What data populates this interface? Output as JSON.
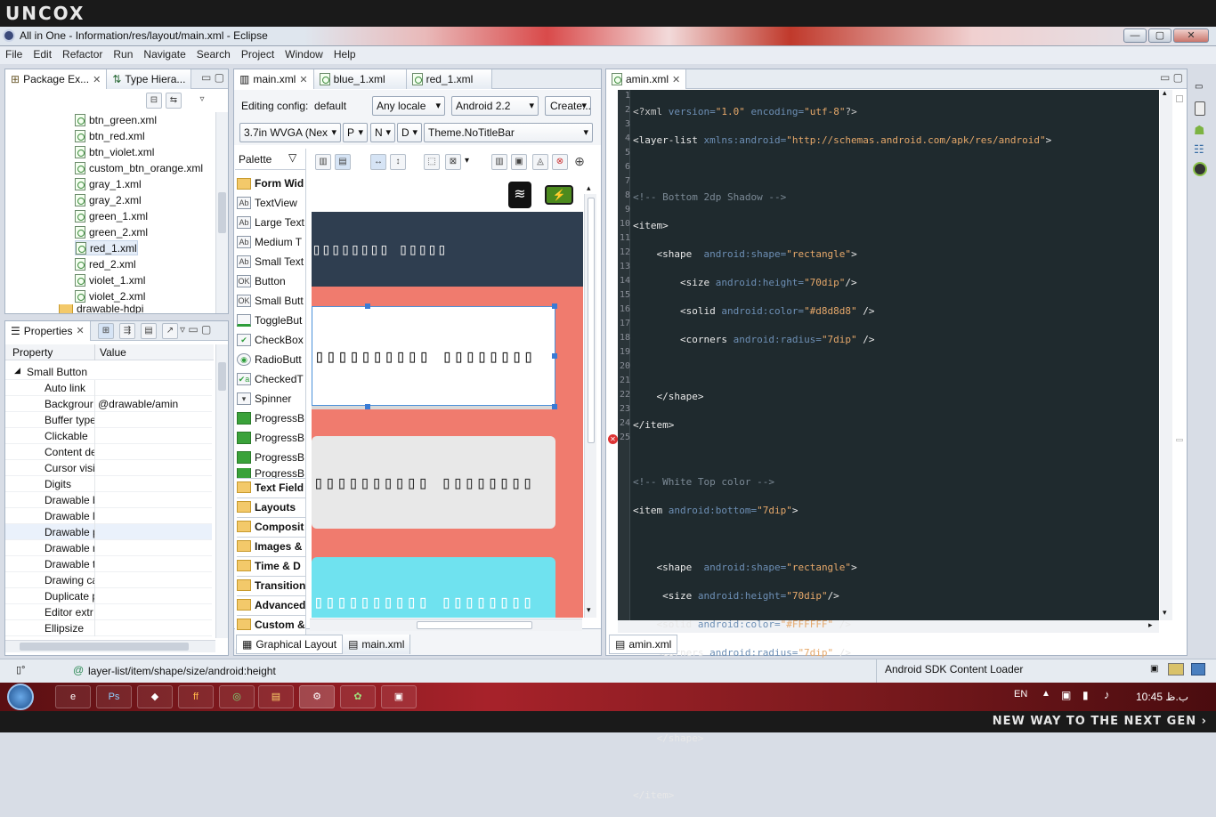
{
  "brand": {
    "logo": "UNCOX",
    "tagline": "NEW WAY TO THE NEXT GEN ›"
  },
  "window": {
    "title": "All in One - Information/res/layout/main.xml - Eclipse",
    "min": "—",
    "max": "▢",
    "close": "✕"
  },
  "menu": [
    "File",
    "Edit",
    "Refactor",
    "Run",
    "Navigate",
    "Search",
    "Project",
    "Window",
    "Help"
  ],
  "package_explorer": {
    "tabs": [
      "Package Ex...",
      "Type Hiera..."
    ],
    "files": [
      "btn_green.xml",
      "btn_red.xml",
      "btn_violet.xml",
      "custom_btn_orange.xml",
      "gray_1.xml",
      "gray_2.xml",
      "green_1.xml",
      "green_2.xml",
      "red_1.xml",
      "red_2.xml",
      "violet_1.xml",
      "violet_2.xml"
    ],
    "selected_index": 8,
    "folder": "drawable-hdpi"
  },
  "properties": {
    "tab": "Properties",
    "col_property": "Property",
    "col_value": "Value",
    "group": "Small Button",
    "rows": [
      {
        "k": "Auto link",
        "v": ""
      },
      {
        "k": "Backgrour",
        "v": "@drawable/amin"
      },
      {
        "k": "Buffer type",
        "v": ""
      },
      {
        "k": "Clickable",
        "v": ""
      },
      {
        "k": "Content de",
        "v": ""
      },
      {
        "k": "Cursor visi",
        "v": ""
      },
      {
        "k": "Digits",
        "v": ""
      },
      {
        "k": "Drawable b",
        "v": ""
      },
      {
        "k": "Drawable l",
        "v": ""
      },
      {
        "k": "Drawable p",
        "v": ""
      },
      {
        "k": "Drawable r",
        "v": ""
      },
      {
        "k": "Drawable t",
        "v": ""
      },
      {
        "k": "Drawing ca",
        "v": ""
      },
      {
        "k": "Duplicate p",
        "v": ""
      },
      {
        "k": "Editor extr",
        "v": ""
      },
      {
        "k": "Ellipsize",
        "v": ""
      }
    ]
  },
  "editor_tabs": [
    "main.xml",
    "blue_1.xml",
    "red_1.xml"
  ],
  "layout_editor": {
    "editing_config_label": "Editing config:",
    "editing_config_value": "default",
    "locale": "Any locale",
    "api": "Android 2.2",
    "create_label": "Create...",
    "device": "3.7in WVGA (Nex",
    "orient": "P",
    "night": "N",
    "dock": "D",
    "theme": "Theme.NoTitleBar",
    "palette_label": "Palette",
    "palette_items": [
      {
        "label": "Form Wid",
        "type": "folder"
      },
      {
        "label": "TextView",
        "type": "Ab"
      },
      {
        "label": "Large Text",
        "type": "Ab"
      },
      {
        "label": "Medium T",
        "type": "Ab"
      },
      {
        "label": "Small Text",
        "type": "Ab"
      },
      {
        "label": "Button",
        "type": "OK"
      },
      {
        "label": "Small Butt",
        "type": "OK"
      },
      {
        "label": "ToggleBut",
        "type": "tg"
      },
      {
        "label": "CheckBox",
        "type": "✔"
      },
      {
        "label": "RadioButt",
        "type": "◉"
      },
      {
        "label": "CheckedT",
        "type": "✔a"
      },
      {
        "label": "Spinner",
        "type": "▾"
      },
      {
        "label": "ProgressB",
        "type": "bar"
      },
      {
        "label": "ProgressB",
        "type": "bar"
      },
      {
        "label": "ProgressB",
        "type": "bar"
      },
      {
        "label": "ProgressB",
        "type": "bar"
      },
      {
        "label": "Text Field",
        "type": "folder"
      },
      {
        "label": "Layouts",
        "type": "folder"
      },
      {
        "label": "Composit",
        "type": "folder"
      },
      {
        "label": "Images &",
        "type": "folder"
      },
      {
        "label": "Time & D",
        "type": "folder"
      },
      {
        "label": "Transition",
        "type": "folder"
      },
      {
        "label": "Advanced",
        "type": "folder"
      },
      {
        "label": "Custom &",
        "type": "folder"
      }
    ],
    "preview_texts": [
      "▯▯▯▯▯▯▯▯ ▯▯▯▯▯",
      "▯▯▯▯▯▯▯▯▯▯ ▯▯▯▯▯▯▯▯",
      "▯▯▯▯▯▯▯▯▯▯ ▯▯▯▯▯▯▯▯",
      "▯▯▯▯▯▯▯▯▯▯ ▯▯▯▯▯▯▯▯"
    ],
    "colors": {
      "header": "#2f3e50",
      "bg": "#f07b6e",
      "card1": "#ffffff",
      "card2": "#e8e8e8",
      "card3": "#6fe2ef"
    },
    "bottom_tabs": [
      "Graphical Layout",
      "main.xml"
    ]
  },
  "code_editor": {
    "tab": "amin.xml",
    "bottom_tab": "amin.xml",
    "line_numbers": [
      "1",
      "2",
      "3",
      "4",
      "5",
      "6",
      "7",
      "8",
      "9",
      "10",
      "11",
      "12",
      "13",
      "14",
      "15",
      "16",
      "17",
      "18",
      "19",
      "20",
      "21",
      "22",
      "23",
      "24",
      "25"
    ]
  },
  "status": {
    "path": "layer-list/item/shape/size/android:height",
    "loader": "Android SDK Content Loader"
  },
  "taskbar": {
    "apps": [
      "e",
      "Ps",
      "◆",
      "ff",
      "◎",
      "▤",
      "⚙",
      "✿",
      "▣"
    ],
    "lang": "EN",
    "time": "10:45 ب.ظ"
  }
}
